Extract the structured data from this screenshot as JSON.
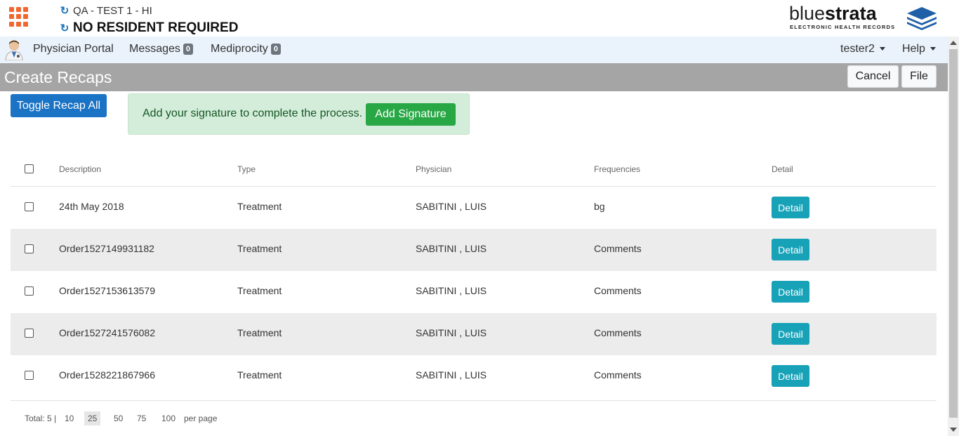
{
  "header": {
    "facility": "QA - TEST 1 - HI",
    "resident": "NO RESIDENT REQUIRED",
    "logo_part1": "blue",
    "logo_part2": "strata",
    "logo_sub": "ELECTRONIC HEALTH RECORDS"
  },
  "nav": {
    "portal": "Physician Portal",
    "messages_label": "Messages",
    "messages_count": "0",
    "mediprocity_label": "Mediprocity",
    "mediprocity_count": "0",
    "user": "tester2",
    "help": "Help"
  },
  "page": {
    "title": "Create Recaps",
    "cancel": "Cancel",
    "file": "File",
    "toggle": "Toggle Recap All",
    "alert_text": "Add your signature to complete the process.",
    "add_signature": "Add Signature"
  },
  "table": {
    "columns": [
      "Description",
      "Type",
      "Physician",
      "Frequencies",
      "Detail"
    ],
    "detail_label": "Detail",
    "rows": [
      {
        "description": "24th May 2018",
        "type": "Treatment",
        "physician": "SABITINI , LUIS",
        "frequencies": "bg"
      },
      {
        "description": "Order1527149931182",
        "type": "Treatment",
        "physician": "SABITINI , LUIS",
        "frequencies": "Comments"
      },
      {
        "description": "Order1527153613579",
        "type": "Treatment",
        "physician": "SABITINI , LUIS",
        "frequencies": "Comments"
      },
      {
        "description": "Order1527241576082",
        "type": "Treatment",
        "physician": "SABITINI , LUIS",
        "frequencies": "Comments"
      },
      {
        "description": "Order1528221867966",
        "type": "Treatment",
        "physician": "SABITINI , LUIS",
        "frequencies": "Comments"
      }
    ]
  },
  "pagination": {
    "total": "Total: 5 |",
    "sizes": [
      "10",
      "25",
      "50",
      "75",
      "100"
    ],
    "active": "25",
    "per_page": "per page"
  },
  "colors": {
    "accent": "#1a73c4",
    "success": "#28a745",
    "info": "#17a2b8",
    "apps_icon": "#f2672f"
  }
}
